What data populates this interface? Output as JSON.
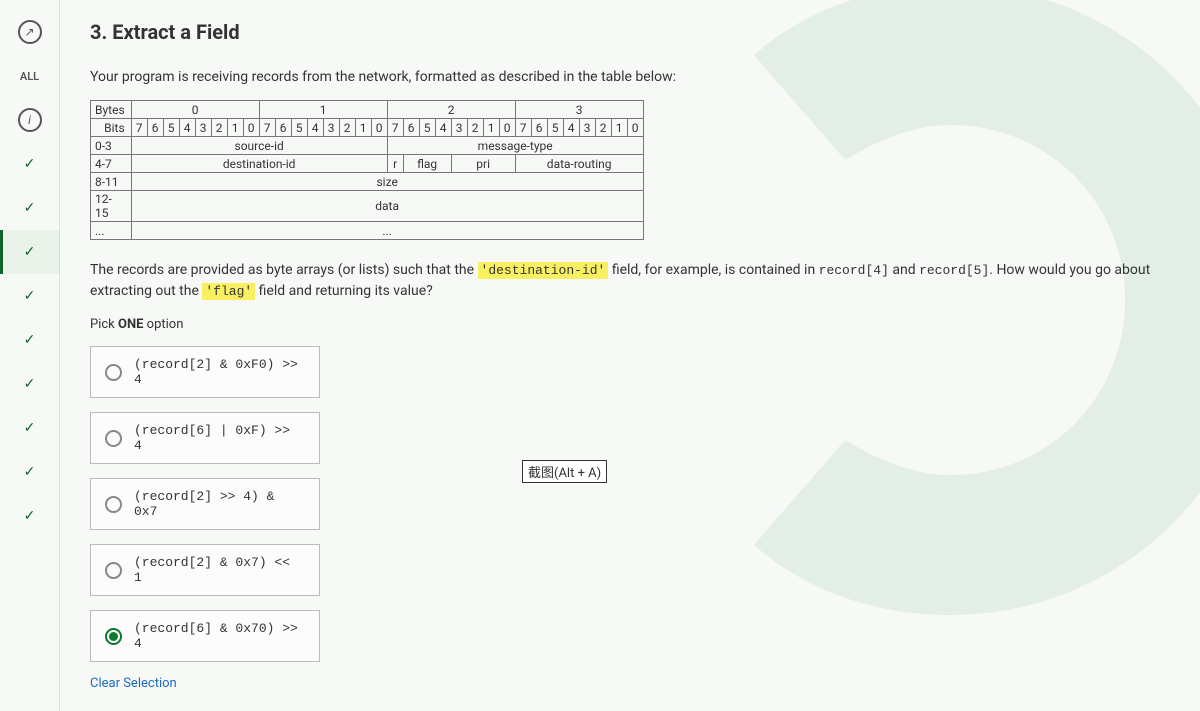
{
  "sidebar": {
    "items": [
      {
        "kind": "icon",
        "name": "hint-icon"
      },
      {
        "kind": "text",
        "label": "ALL"
      },
      {
        "kind": "icon",
        "name": "info-icon"
      },
      {
        "kind": "check"
      },
      {
        "kind": "check"
      },
      {
        "kind": "check",
        "active": true
      },
      {
        "kind": "check"
      },
      {
        "kind": "check"
      },
      {
        "kind": "check"
      },
      {
        "kind": "check"
      },
      {
        "kind": "check"
      },
      {
        "kind": "check"
      }
    ]
  },
  "question": {
    "title": "3. Extract a Field",
    "intro": "Your program is receiving records from the network, formatted as described in the table below:",
    "table": {
      "header_label": "Bytes",
      "byte_headers": [
        "0",
        "1",
        "2",
        "3"
      ],
      "bits_label": "Bits",
      "bit_sequence": [
        "7",
        "6",
        "5",
        "4",
        "3",
        "2",
        "1",
        "0",
        "7",
        "6",
        "5",
        "4",
        "3",
        "2",
        "1",
        "0",
        "7",
        "6",
        "5",
        "4",
        "3",
        "2",
        "1",
        "0",
        "7",
        "6",
        "5",
        "4",
        "3",
        "2",
        "1",
        "0"
      ],
      "rows": [
        {
          "range": "0-3",
          "fields": [
            {
              "span": 16,
              "label": "source-id"
            },
            {
              "span": 16,
              "label": "message-type"
            }
          ]
        },
        {
          "range": "4-7",
          "fields": [
            {
              "span": 16,
              "label": "destination-id"
            },
            {
              "span": 1,
              "label": "r"
            },
            {
              "span": 3,
              "label": "flag"
            },
            {
              "span": 4,
              "label": "pri"
            },
            {
              "span": 8,
              "label": "data-routing"
            }
          ]
        },
        {
          "range": "8-11",
          "fields": [
            {
              "span": 32,
              "label": "size"
            }
          ]
        },
        {
          "range": "12-15",
          "fields": [
            {
              "span": 32,
              "label": "data"
            }
          ]
        },
        {
          "range": "...",
          "fields": [
            {
              "span": 32,
              "label": "..."
            }
          ]
        }
      ]
    },
    "para_pre": "The records are provided as byte arrays (or lists) such that the ",
    "code1": "'destination-id'",
    "para_mid1": " field, for example, is contained in ",
    "code2": "record[4]",
    "para_mid2": " and ",
    "code3": "record[5]",
    "para_mid3": ". How would you go about extracting out the ",
    "code4": "'flag'",
    "para_post": " field and returning its value?",
    "pick_label_pre": "Pick ",
    "pick_label_bold": "ONE",
    "pick_label_post": " option",
    "options": [
      {
        "text": "(record[2] & 0xF0) >> 4",
        "selected": false
      },
      {
        "text": "(record[6] | 0xF) >> 4",
        "selected": false
      },
      {
        "text": "(record[2] >> 4) & 0x7",
        "selected": false
      },
      {
        "text": "(record[2] & 0x7) << 1",
        "selected": false
      },
      {
        "text": "(record[6] & 0x70) >> 4",
        "selected": true
      }
    ],
    "clear_label": "Clear Selection"
  },
  "tooltip": "截图(Alt + A)"
}
